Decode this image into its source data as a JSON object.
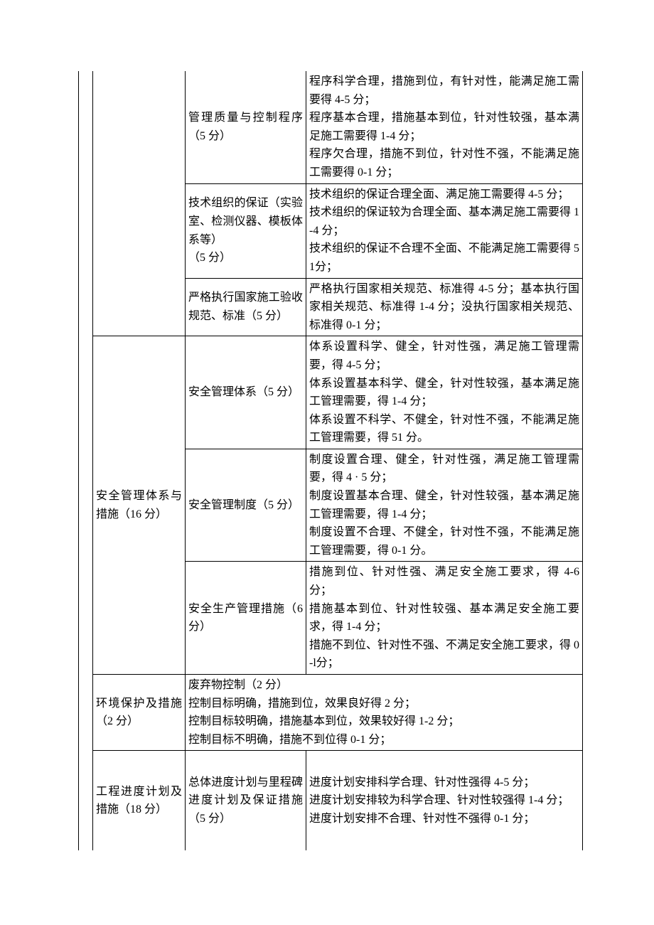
{
  "rows": [
    {
      "sub": "管理质量与控制程序（5 分）",
      "crit": "程序科学合理，措施到位，有针对性，能满足施工需要得 4-5 分；\n程序基本合理，措施基本到位，针对性较强，基本满足施工需要得 1-4 分；\n程序欠合理，措施不到位，针对性不强，不能满足施工需要得 0-1 分；"
    },
    {
      "sub": "技术组织的保证（实验室、检测仪器、模板体系等）\n（5 分）",
      "crit": "技术组织的保证合理全面、满足施工需要得 4-5 分；\n技术组织的保证较为合理全面、基本满足施工需要得 1-4 分；\n技术组织的保证不合理不全面、不能满足施工需要得 51分；"
    },
    {
      "sub": "严格执行国家施工验收规范、标准（5 分）",
      "crit": "严格执行国家相关规范、标准得 4-5 分；基本执行国家相关规范、标准得 1-4 分；没执行国家相关规范、标准得 0-1 分；"
    },
    {
      "cat": "安全管理体系与措施（16 分）",
      "sub": "安全管理体系（5 分）",
      "crit": "体系设置科学、健全，针对性强，满足施工管理需要，得 4-5 分；\n体系设置基本科学、健全，针对性较强，基本满足施工管理需要，得 1-4 分；\n体系设置不科学、不健全，针对性不强，不能满足施工管理需要，得 51 分。"
    },
    {
      "sub": "安全管理制度（5 分）",
      "crit": "制度设置合理、健全，针对性强，满足施工管理需要，得 4 · 5 分；\n制度设置基本合理、健全，针对性较强，基本满足施工管理需要，得 1-4 分；\n制度设置不合理、不健全，针对性不强，不能满足施工管理需要，得 0-1 分。"
    },
    {
      "sub": "安全生产管理措施（6 分）",
      "crit": "措施到位、针对性强、满足安全施工要求，得 4-6 分；\n措施基本到位、针对性较强、基本满足安全施工要求，得 1-4 分；\n措施不到位、针对性不强、不满足安全施工要求，得 0-l分；"
    },
    {
      "cat": "环境保护及措施（2 分）",
      "merged": "废弃物控制（2 分）\n控制目标明确，措施到位，效果良好得 2 分；\n控制目标较明确，措施基本到位，效果较好得 1-2 分；\n控制目标不明确，措施不到位得 0-1 分；"
    },
    {
      "cat": "工程进度计划及措施（18 分）",
      "sub": "总体进度计划与里程碑进度计划及保证措施（5 分）",
      "crit": "进度计划安排科学合理、针对性强得 4-5 分；\n进度计划安排较为科学合理、针对性较强得 1-4 分；\n进度计划安排不合理、针对性不强得 0-1 分；"
    }
  ]
}
